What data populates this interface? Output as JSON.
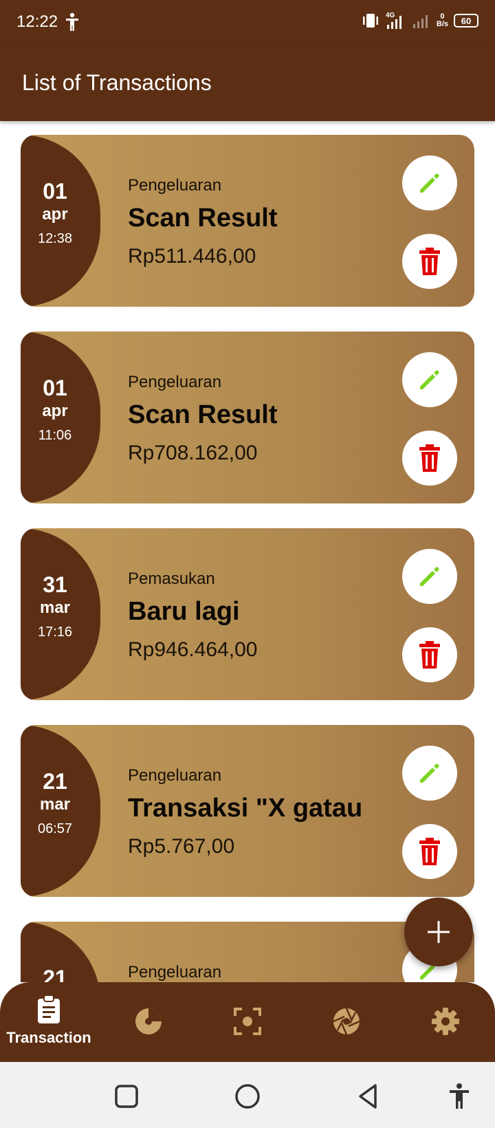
{
  "status_bar": {
    "time": "12:22",
    "network": "4G",
    "speed_value": "0",
    "speed_unit": "B/s",
    "battery": "60"
  },
  "app_bar": {
    "title": "List of Transactions"
  },
  "transactions": [
    {
      "day": "01",
      "month": "apr",
      "time": "12:38",
      "type": "Pengeluaran",
      "title": "Scan Result",
      "amount": "Rp511.446,00"
    },
    {
      "day": "01",
      "month": "apr",
      "time": "11:06",
      "type": "Pengeluaran",
      "title": "Scan Result",
      "amount": "Rp708.162,00"
    },
    {
      "day": "31",
      "month": "mar",
      "time": "17:16",
      "type": "Pemasukan",
      "title": "Baru lagi",
      "amount": "Rp946.464,00"
    },
    {
      "day": "21",
      "month": "mar",
      "time": "06:57",
      "type": "Pengeluaran",
      "title": "Transaksi \"X gatau",
      "amount": "Rp5.767,00"
    },
    {
      "day": "21",
      "month": "",
      "time": "",
      "type": "Pengeluaran",
      "title": "",
      "amount": ""
    }
  ],
  "bottom_nav": {
    "items": [
      {
        "label": "Transaction",
        "icon": "clipboard-icon",
        "active": true
      },
      {
        "label": "",
        "icon": "pie-chart-icon",
        "active": false
      },
      {
        "label": "",
        "icon": "scan-icon",
        "active": false
      },
      {
        "label": "",
        "icon": "aperture-icon",
        "active": false
      },
      {
        "label": "",
        "icon": "gear-icon",
        "active": false
      }
    ]
  },
  "colors": {
    "primary": "#5c2f14",
    "card_gradient_start": "#c09a59",
    "card_gradient_end": "#9f7344",
    "edit_icon": "#7dd321",
    "delete_icon": "#e00000",
    "icon_tan": "#c9a46a"
  },
  "system_nav": {
    "icons": [
      "recents-icon",
      "home-icon",
      "back-icon",
      "accessibility-icon"
    ]
  }
}
